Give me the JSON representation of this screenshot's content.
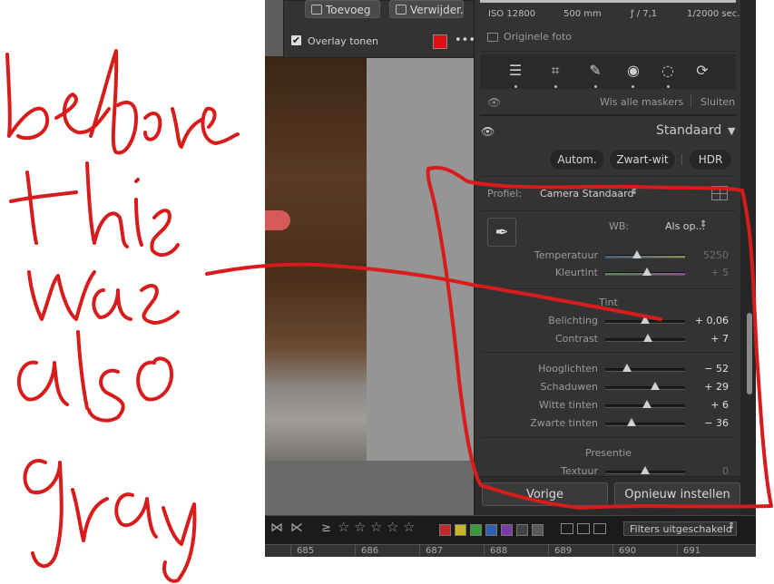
{
  "overlay": {
    "add_label": "Toevoeg",
    "delete_label": "Verwijder.",
    "show_overlay_label": "Overlay tonen",
    "overlay_color": "#dd1111"
  },
  "histogram": {
    "iso": "ISO 12800",
    "focal": "500 mm",
    "aperture": "ƒ / 7,1",
    "shutter": "1/2000 sec.",
    "original_photo_label": "Originele foto"
  },
  "masks": {
    "clear_all_label": "Wis alle maskers",
    "close_label": "Sluiten"
  },
  "basic": {
    "preset_label": "Standaard",
    "auto_label": "Autom.",
    "bw_label": "Zwart-wit",
    "hdr_label": "HDR",
    "profile_label": "Profiel:",
    "profile_value": "Camera Standaard",
    "wb_label": "WB:",
    "wb_value": "Als op...",
    "sliders_wb": [
      {
        "label": "Temperatuur",
        "value": "5250",
        "pos": 0.4,
        "dim": true
      },
      {
        "label": "Kleurtint",
        "value": "+ 5",
        "pos": 0.52,
        "dim": true
      }
    ],
    "tint_section": "Tint",
    "sliders_tone": [
      {
        "label": "Belichting",
        "value": "+ 0,06",
        "pos": 0.5
      },
      {
        "label": "Contrast",
        "value": "+ 7",
        "pos": 0.53
      }
    ],
    "sliders_detail": [
      {
        "label": "Hooglichten",
        "value": "− 52",
        "pos": 0.27
      },
      {
        "label": "Schaduwen",
        "value": "+ 29",
        "pos": 0.63
      },
      {
        "label": "Witte tinten",
        "value": "+ 6",
        "pos": 0.52
      },
      {
        "label": "Zwarte tinten",
        "value": "− 36",
        "pos": 0.33
      }
    ],
    "presence_section": "Presentie",
    "sliders_presence": [
      {
        "label": "Textuur",
        "value": "0",
        "pos": 0.5,
        "dim": true
      }
    ]
  },
  "footer": {
    "previous_label": "Vorige",
    "reset_label": "Opnieuw instellen"
  },
  "filmstrip": {
    "rating_prefix": "≥",
    "filters_label": "Filters uitgeschakeld",
    "color_labels": [
      "#c42a2a",
      "#c8b52a",
      "#3a9a3a",
      "#2f5fb0",
      "#7a3aa8",
      "#444444",
      "#5a5a5a"
    ],
    "ruler": [
      "685",
      "686",
      "687",
      "688",
      "689",
      "690",
      "691"
    ]
  },
  "annotation": {
    "handwritten": [
      "before",
      "this",
      "was",
      "also",
      "gray"
    ]
  }
}
